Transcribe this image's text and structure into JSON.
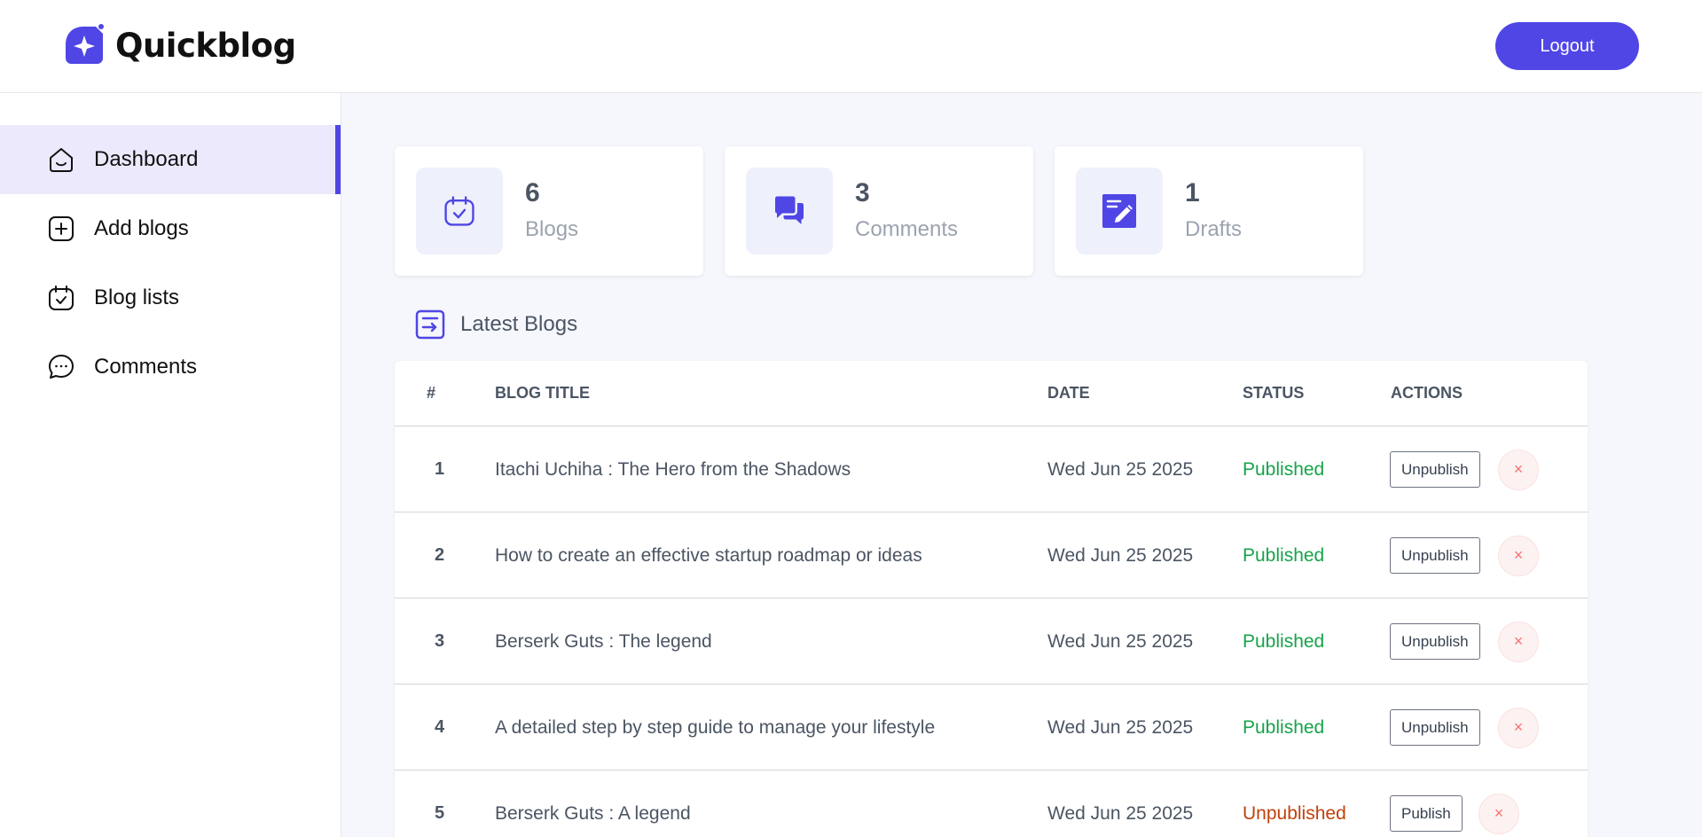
{
  "header": {
    "brand_name": "Quickblog",
    "logout_label": "Logout"
  },
  "sidebar": {
    "items": [
      {
        "label": "Dashboard",
        "icon": "home-icon",
        "active": true
      },
      {
        "label": "Add blogs",
        "icon": "add-square-icon",
        "active": false
      },
      {
        "label": "Blog lists",
        "icon": "calendar-check-icon",
        "active": false
      },
      {
        "label": "Comments",
        "icon": "chat-bubble-icon",
        "active": false
      }
    ]
  },
  "stats": [
    {
      "value": "6",
      "label": "Blogs",
      "icon": "calendar-check-icon"
    },
    {
      "value": "3",
      "label": "Comments",
      "icon": "chat-bubbles-icon"
    },
    {
      "value": "1",
      "label": "Drafts",
      "icon": "edit-document-icon"
    }
  ],
  "latest_blogs": {
    "title": "Latest Blogs",
    "icon": "list-arrow-icon",
    "columns": [
      "#",
      "BLOG TITLE",
      "DATE",
      "STATUS",
      "ACTIONS"
    ],
    "rows": [
      {
        "num": "1",
        "title": "Itachi Uchiha : The Hero from the Shadows",
        "date": "Wed Jun 25 2025",
        "status": "Published",
        "action": "Unpublish",
        "delete": "×"
      },
      {
        "num": "2",
        "title": "How to create an effective startup roadmap or ideas",
        "date": "Wed Jun 25 2025",
        "status": "Published",
        "action": "Unpublish",
        "delete": "×"
      },
      {
        "num": "3",
        "title": "Berserk Guts : The legend",
        "date": "Wed Jun 25 2025",
        "status": "Published",
        "action": "Unpublish",
        "delete": "×"
      },
      {
        "num": "4",
        "title": "A detailed step by step guide to manage your lifestyle",
        "date": "Wed Jun 25 2025",
        "status": "Published",
        "action": "Unpublish",
        "delete": "×"
      },
      {
        "num": "5",
        "title": "Berserk Guts : A legend",
        "date": "Wed Jun 25 2025",
        "status": "Unpublished",
        "action": "Publish",
        "delete": "×"
      }
    ]
  },
  "colors": {
    "accent": "#4f46e5",
    "published": "#16a34a",
    "unpublished": "#c2410c"
  }
}
